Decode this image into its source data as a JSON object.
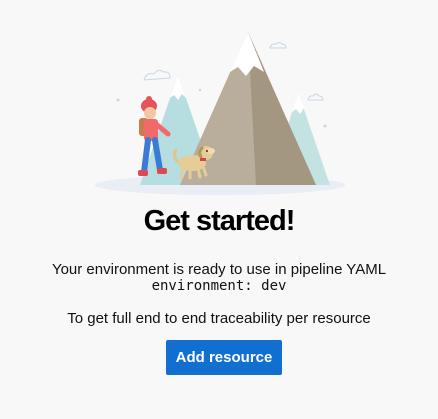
{
  "empty_state": {
    "title": "Get started!",
    "message": "Your environment is ready to use in pipeline YAML",
    "code": "environment: dev",
    "secondary_message": "To get full end to end traceability per resource",
    "action_label": "Add resource"
  },
  "colors": {
    "background": "#f8f8f8",
    "button": "#1170cf",
    "button_text": "#ffffff"
  },
  "illustration": {
    "name": "hiker-with-dog-and-mountains"
  }
}
